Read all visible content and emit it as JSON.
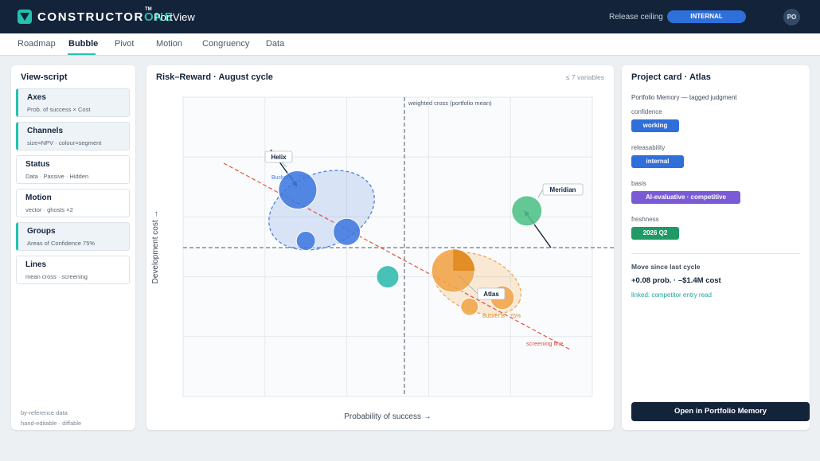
{
  "app": {
    "brand_main": "CONSTRUCTOR",
    "brand_accent": "ONE",
    "brand_tm": "TM",
    "product": "PortView",
    "release_ceiling_label": "Release ceiling",
    "release_ceiling_value": "INTERNAL",
    "avatar_initials": "PO",
    "accent_color": "#25c1b0"
  },
  "tabs": [
    {
      "label": "Roadmap",
      "active": false
    },
    {
      "label": "Bubble",
      "active": true
    },
    {
      "label": "Pivot",
      "active": false
    },
    {
      "label": "Motion",
      "active": false
    },
    {
      "label": "Congruency",
      "active": false
    },
    {
      "label": "Data",
      "active": false
    }
  ],
  "view_script": {
    "title": "View-script",
    "items": [
      {
        "title": "Axes",
        "subtitle": "Prob. of success × Cost",
        "active": true
      },
      {
        "title": "Channels",
        "subtitle": "size=NPV · colour=segment",
        "active": true
      },
      {
        "title": "Status",
        "subtitle": "Data · Passive · Hidden",
        "active": false
      },
      {
        "title": "Motion",
        "subtitle": "vector · ghosts ×2",
        "active": false
      },
      {
        "title": "Groups",
        "subtitle": "Areas of Confidence 75%",
        "active": true
      },
      {
        "title": "Lines",
        "subtitle": "mean cross · screening",
        "active": false
      }
    ],
    "footer_line1": "by-reference data",
    "footer_line2": "hand-editable · diffable"
  },
  "chart": {
    "title": "Risk–Reward · August cycle",
    "variable_limit": "≤ 7 variables",
    "mean_cross_label": "weighted cross (portfolio mean)",
    "screening_label": "screening line",
    "x_axis_label": "Probability of success →",
    "y_axis_label": "Development cost →",
    "labels": {
      "helix": "Helix",
      "meridian": "Meridian",
      "atlas": "Atlas",
      "bucket_a": "Bucket A · 75%",
      "bucket_b": "Bucket B · 75%"
    }
  },
  "chart_data": {
    "type": "scatter",
    "title": "Risk–Reward · August cycle",
    "xlabel": "Probability of success →",
    "ylabel": "Development cost →",
    "grid": true,
    "reference_lines": [
      "weighted cross (portfolio mean)",
      "screening line"
    ],
    "groups": [
      {
        "name": "Bucket A · 75%",
        "color": "#3f79e0"
      },
      {
        "name": "Bucket B · 75%",
        "color": "#f0a44a"
      }
    ],
    "points": [
      {
        "label": "Helix",
        "x": 0.28,
        "y": 0.69,
        "size": 24,
        "color": "#3f79e0",
        "group": "Bucket A · 75%"
      },
      {
        "label": "",
        "x": 0.4,
        "y": 0.55,
        "size": 17,
        "color": "#3f79e0",
        "group": "Bucket A · 75%"
      },
      {
        "label": "",
        "x": 0.3,
        "y": 0.52,
        "size": 12,
        "color": "#3f79e0",
        "group": "Bucket A · 75%"
      },
      {
        "label": "Meridian",
        "x": 0.84,
        "y": 0.62,
        "size": 19,
        "color": "#4fbf87",
        "group": ""
      },
      {
        "label": "",
        "x": 0.5,
        "y": 0.4,
        "size": 14,
        "color": "#2fb8ad",
        "group": ""
      },
      {
        "label": "Atlas",
        "x": 0.66,
        "y": 0.42,
        "size": 27,
        "color": "#f0a44a",
        "group": "Bucket B · 75%"
      },
      {
        "label": "",
        "x": 0.78,
        "y": 0.33,
        "size": 15,
        "color": "#f0a44a",
        "group": "Bucket B · 75%"
      },
      {
        "label": "",
        "x": 0.7,
        "y": 0.3,
        "size": 11,
        "color": "#f0a44a",
        "group": "Bucket B · 75%"
      }
    ]
  },
  "project_card": {
    "title": "Project card · Atlas",
    "memory_heading": "Portfolio Memory — tagged judgment",
    "fields": [
      {
        "label": "confidence",
        "value": "working",
        "color": "#2f6fd9"
      },
      {
        "label": "releasability",
        "value": "internal",
        "color": "#2f6fd9"
      },
      {
        "label": "basis",
        "value": "AI-evaluative · competitive",
        "color": "#7b5ad6"
      },
      {
        "label": "freshness",
        "value": "2026 Q2",
        "color": "#1f9a66"
      }
    ],
    "move_title": "Move since last cycle",
    "move_value": "+0.08 prob. · –$1.4M cost",
    "move_link": "linked: competitor entry read",
    "open_button": "Open in Portfolio Memory"
  }
}
